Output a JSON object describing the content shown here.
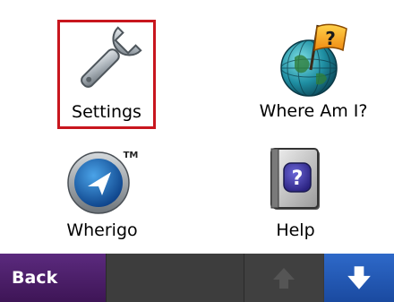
{
  "menu": {
    "items": [
      {
        "label": "Settings",
        "icon": "wrench-icon",
        "selected": true
      },
      {
        "label": "Where Am I?",
        "icon": "globe-flag-icon",
        "selected": false
      },
      {
        "label": "Wherigo",
        "icon": "wherigo-compass-icon",
        "selected": false
      },
      {
        "label": "Help",
        "icon": "help-book-icon",
        "selected": false
      }
    ]
  },
  "footer": {
    "back_label": "Back",
    "scroll_up_icon": "arrow-up-icon",
    "scroll_up_enabled": false,
    "scroll_down_icon": "arrow-down-icon",
    "scroll_down_enabled": true
  },
  "colors": {
    "selection_border": "#c8161e",
    "back_button": "#4a1f66",
    "down_button": "#2459b5",
    "bar": "#3a3a3a"
  }
}
